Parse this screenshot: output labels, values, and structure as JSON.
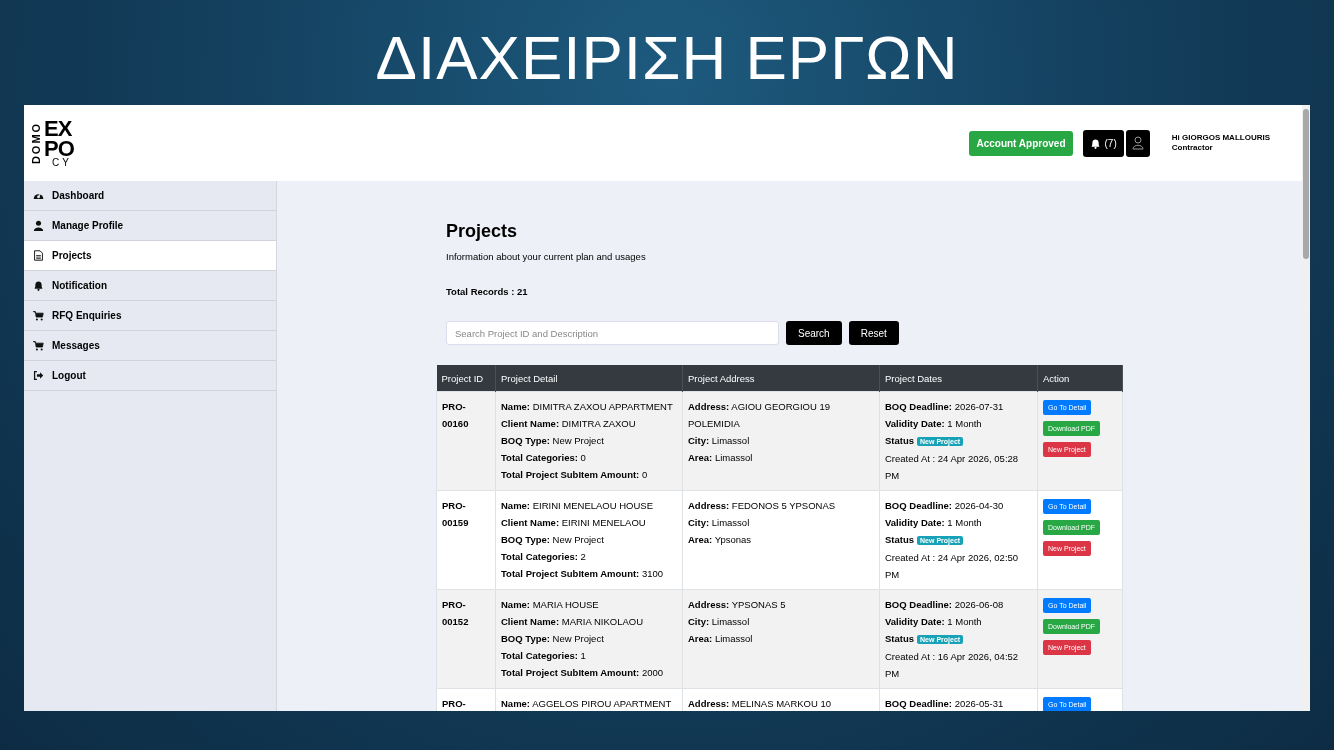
{
  "slide_title": "ΔΙΑΧΕΙΡΙΣΗ ΕΡΓΩΝ",
  "logo": {
    "side": "DOMO",
    "line1": "EX",
    "line2": "PO",
    "line3": "CY"
  },
  "header": {
    "account_status": "Account Approved",
    "notifications": "(7)",
    "greeting": "Hi GIORGOS MALLOURIS",
    "role": "Contractor"
  },
  "sidebar": {
    "items": [
      {
        "label": "Dashboard",
        "kind": "dashboard",
        "selected": false
      },
      {
        "label": "Manage Profile",
        "kind": "user",
        "selected": false
      },
      {
        "label": "Projects",
        "kind": "file",
        "selected": true
      },
      {
        "label": "Notification",
        "kind": "bell",
        "selected": false
      },
      {
        "label": "RFQ Enquiries",
        "kind": "cart",
        "selected": false
      },
      {
        "label": "Messages",
        "kind": "cart",
        "selected": false
      },
      {
        "label": "Logout",
        "kind": "logout",
        "selected": false
      }
    ]
  },
  "page": {
    "title": "Projects",
    "subtitle": "Information about your current plan and usages",
    "total_records": "Total Records : 21"
  },
  "search": {
    "placeholder": "Search Project ID and Description",
    "buttons": [
      "Search",
      "Reset"
    ]
  },
  "table": {
    "columns": [
      "Project ID",
      "Project Detail",
      "Project Address",
      "Project Dates",
      "Action"
    ],
    "rows": [
      {
        "id": "PRO-00160",
        "detail": [
          {
            "label": "Name:",
            "value": "DIMITRA ZAXOU APPARTMENT"
          },
          {
            "label": "Client Name:",
            "value": "DIMITRA ZAXOU"
          },
          {
            "label": "BOQ Type:",
            "value": "New Project"
          },
          {
            "label": "Total Categories:",
            "value": "0"
          },
          {
            "label": "Total Project SubItem Amount:",
            "value": "0"
          }
        ],
        "address": [
          {
            "label": "Address:",
            "value": "AGIOU GEORGIOU 19 POLEMIDIA"
          },
          {
            "label": "City:",
            "value": "Limassol"
          },
          {
            "label": "Area:",
            "value": "Limassol"
          }
        ],
        "dates": [
          {
            "label": "BOQ Deadline:",
            "value": "2026-07-31"
          },
          {
            "label": "Validity Date:",
            "value": "1 Month"
          }
        ],
        "status_label": "Status",
        "status": "New Project",
        "created": "Created At : 24 Apr 2026, 05:28 PM",
        "actions": [
          {
            "label": "Go To Detail",
            "kind": "primary"
          },
          {
            "label": "Download PDF",
            "kind": "success"
          },
          {
            "label": "New Project",
            "kind": "danger"
          }
        ]
      },
      {
        "id": "PRO-00159",
        "detail": [
          {
            "label": "Name:",
            "value": "EIRINI MENELAOU HOUSE"
          },
          {
            "label": "Client Name:",
            "value": "EIRINI MENELAOU"
          },
          {
            "label": "BOQ Type:",
            "value": "New Project"
          },
          {
            "label": "Total Categories:",
            "value": "2"
          },
          {
            "label": "Total Project SubItem Amount:",
            "value": "3100"
          }
        ],
        "address": [
          {
            "label": "Address:",
            "value": "FEDONOS 5 YPSONAS"
          },
          {
            "label": "City:",
            "value": "Limassol"
          },
          {
            "label": "Area:",
            "value": "Ypsonas"
          }
        ],
        "dates": [
          {
            "label": "BOQ Deadline:",
            "value": "2026-04-30"
          },
          {
            "label": "Validity Date:",
            "value": "1 Month"
          }
        ],
        "status_label": "Status",
        "status": "New Project",
        "created": "Created At : 24 Apr 2026, 02:50 PM",
        "actions": [
          {
            "label": "Go To Detail",
            "kind": "primary"
          },
          {
            "label": "Download PDF",
            "kind": "success"
          },
          {
            "label": "New Project",
            "kind": "danger"
          }
        ]
      },
      {
        "id": "PRO-00152",
        "detail": [
          {
            "label": "Name:",
            "value": "MARIA HOUSE"
          },
          {
            "label": "Client Name:",
            "value": "MARIA NIKOLAOU"
          },
          {
            "label": "BOQ Type:",
            "value": "New Project"
          },
          {
            "label": "Total Categories:",
            "value": "1"
          },
          {
            "label": "Total Project SubItem Amount:",
            "value": "2000"
          }
        ],
        "address": [
          {
            "label": "Address:",
            "value": "YPSONAS 5"
          },
          {
            "label": "City:",
            "value": "Limassol"
          },
          {
            "label": "Area:",
            "value": "Limassol"
          }
        ],
        "dates": [
          {
            "label": "BOQ Deadline:",
            "value": "2026-06-08"
          },
          {
            "label": "Validity Date:",
            "value": "1 Month"
          }
        ],
        "status_label": "Status",
        "status": "New Project",
        "created": "Created At : 16 Apr 2026, 04:52 PM",
        "actions": [
          {
            "label": "Go To Detail",
            "kind": "primary"
          },
          {
            "label": "Download PDF",
            "kind": "success"
          },
          {
            "label": "New Project",
            "kind": "danger"
          }
        ]
      },
      {
        "id": "PRO-",
        "detail": [
          {
            "label": "Name:",
            "value": "AGGELOS PIROU APARTMENT"
          }
        ],
        "address": [
          {
            "label": "Address:",
            "value": "MELINAS MARKOU 10"
          }
        ],
        "dates": [
          {
            "label": "BOQ Deadline:",
            "value": "2026-05-31"
          }
        ],
        "actions": [
          {
            "label": "Go To Detail",
            "kind": "primary"
          }
        ]
      }
    ]
  }
}
